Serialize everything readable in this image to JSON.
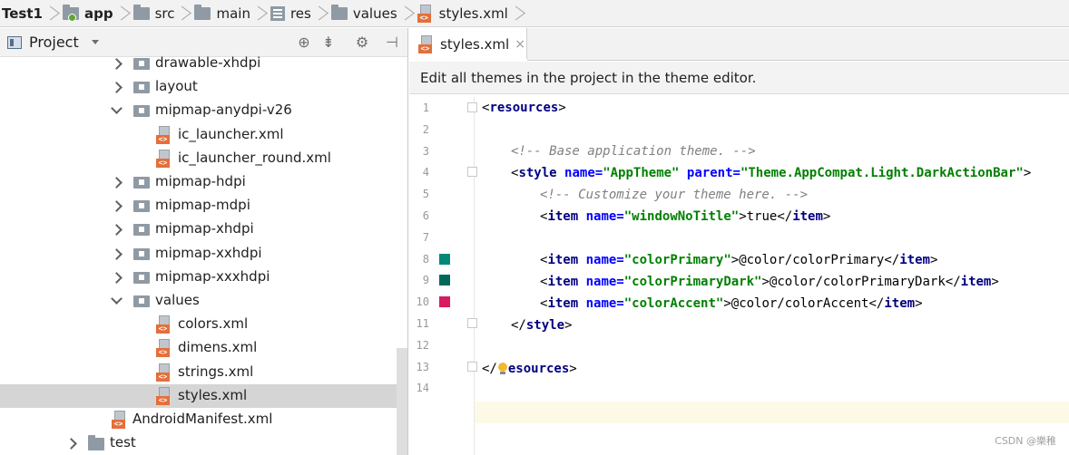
{
  "breadcrumb": [
    {
      "label": "Test1",
      "icon": "",
      "bold": true
    },
    {
      "label": "app",
      "icon": "app-module-icon",
      "bold": true
    },
    {
      "label": "src",
      "icon": "folder-icon",
      "bold": false
    },
    {
      "label": "main",
      "icon": "folder-icon",
      "bold": false
    },
    {
      "label": "res",
      "icon": "res-folder-icon",
      "bold": false
    },
    {
      "label": "values",
      "icon": "folder-icon",
      "bold": false
    },
    {
      "label": "styles.xml",
      "icon": "xml-file-icon",
      "bold": false
    }
  ],
  "project_panel": {
    "title": "Project",
    "tools": [
      "target-icon",
      "collapse-icon",
      "gear-icon",
      "hide-icon"
    ]
  },
  "tree": [
    {
      "label": "drawable-xhdpi",
      "type": "folder",
      "expanded": false
    },
    {
      "label": "layout",
      "type": "folder",
      "expanded": false
    },
    {
      "label": "mipmap-anydpi-v26",
      "type": "folder",
      "expanded": true
    },
    {
      "label": "ic_launcher.xml",
      "type": "xml"
    },
    {
      "label": "ic_launcher_round.xml",
      "type": "xml"
    },
    {
      "label": "mipmap-hdpi",
      "type": "folder",
      "expanded": false
    },
    {
      "label": "mipmap-mdpi",
      "type": "folder",
      "expanded": false
    },
    {
      "label": "mipmap-xhdpi",
      "type": "folder",
      "expanded": false
    },
    {
      "label": "mipmap-xxhdpi",
      "type": "folder",
      "expanded": false
    },
    {
      "label": "mipmap-xxxhdpi",
      "type": "folder",
      "expanded": false
    },
    {
      "label": "values",
      "type": "folder",
      "expanded": true
    },
    {
      "label": "colors.xml",
      "type": "xml"
    },
    {
      "label": "dimens.xml",
      "type": "xml"
    },
    {
      "label": "strings.xml",
      "type": "xml"
    },
    {
      "label": "styles.xml",
      "type": "xml",
      "selected": true
    },
    {
      "label": "AndroidManifest.xml",
      "type": "manifest"
    },
    {
      "label": "test",
      "type": "plain-folder",
      "expanded": false
    }
  ],
  "editor": {
    "tab_label": "styles.xml",
    "tab_close": "×",
    "banner": "Edit all themes in the project in the theme editor.",
    "line_numbers": [
      "1",
      "2",
      "3",
      "4",
      "5",
      "6",
      "7",
      "8",
      "9",
      "10",
      "11",
      "12",
      "13",
      "14"
    ],
    "swatches": {
      "8": "#00897b",
      "9": "#00695c",
      "10": "#d81b60"
    },
    "code": {
      "l1_tag": "resources",
      "l3_comment": "<!-- Base application theme. -->",
      "l4_tag": "style",
      "l4_attr1": "name=",
      "l4_val1": "\"AppTheme\"",
      "l4_attr2": "parent=",
      "l4_val2": "\"Theme.AppCompat.Light.DarkActionBar\"",
      "l5_comment": "<!-- Customize your theme here. -->",
      "item_tag": "item",
      "name_attr": "name=",
      "l6_val": "\"windowNoTitle\"",
      "l6_text": "true",
      "l8_val": "\"colorPrimary\"",
      "l8_text": "@color/colorPrimary",
      "l9_val": "\"colorPrimaryDark\"",
      "l9_text": "@color/colorPrimaryDark",
      "l10_val": "\"colorAccent\"",
      "l10_text": "@color/colorAccent",
      "l11_tag": "style",
      "l13_tag": "esources"
    }
  },
  "watermark": "CSDN @樂稚",
  "colors": {
    "accent_selected_row": "#d5d5d5",
    "current_line": "#fcfae6",
    "xml_tag": "#000080",
    "xml_attr": "#0000ff",
    "xml_value": "#008000",
    "comment": "#808080"
  }
}
